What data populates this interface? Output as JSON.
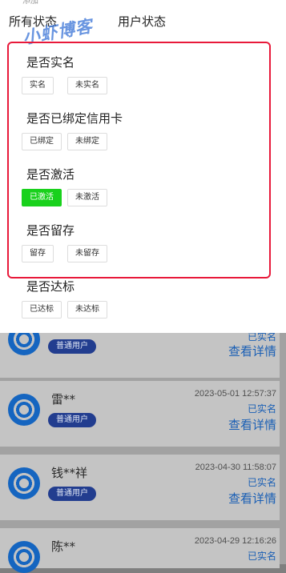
{
  "top_clipped_text": "添加",
  "tabs": {
    "all_status": "所有状态",
    "user_status": "用户状态"
  },
  "watermark": "小虾博客",
  "filters": [
    {
      "title": "是否实名",
      "options": [
        {
          "label": "实名",
          "active": false
        },
        {
          "label": "未实名",
          "active": false
        }
      ]
    },
    {
      "title": "是否已绑定信用卡",
      "options": [
        {
          "label": "已绑定",
          "active": false
        },
        {
          "label": "未绑定",
          "active": false
        }
      ]
    },
    {
      "title": "是否激活",
      "options": [
        {
          "label": "已激活",
          "active": true
        },
        {
          "label": "未激活",
          "active": false
        }
      ]
    },
    {
      "title": "是否留存",
      "options": [
        {
          "label": "留存",
          "active": false
        },
        {
          "label": "未留存",
          "active": false
        }
      ]
    },
    {
      "title": "是否达标",
      "options": [
        {
          "label": "已达标",
          "active": false
        },
        {
          "label": "未达标",
          "active": false
        }
      ]
    }
  ],
  "users": [
    {
      "name": "",
      "tag": "普通用户",
      "date": "",
      "status": "已实名",
      "detail": "查看详情"
    },
    {
      "name": "雷**",
      "tag": "普通用户",
      "date": "2023-05-01 12:57:37",
      "status": "已实名",
      "detail": "查看详情"
    },
    {
      "name": "钱**祥",
      "tag": "普通用户",
      "date": "2023-04-30 11:58:07",
      "status": "已实名",
      "detail": "查看详情"
    },
    {
      "name": "陈**",
      "tag": "",
      "date": "2023-04-29 12:16:26",
      "status": "已实名",
      "detail": ""
    }
  ],
  "colors": {
    "active_green": "#19d11c",
    "highlight_red": "#e8193a",
    "link_blue": "#1a5fb5",
    "tag_navy": "#223d8f"
  }
}
